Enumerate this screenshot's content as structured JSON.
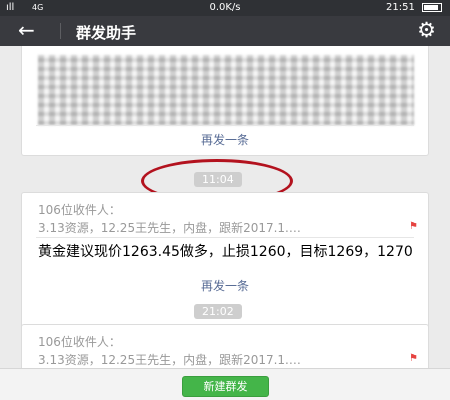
{
  "status_bar": {
    "signal": "ıll",
    "network": "4G",
    "speed": "0.0K/s",
    "time": "21:51",
    "battery_level": 0.9
  },
  "header": {
    "back_icon": "arrow-left-icon",
    "title": "群发助手",
    "settings_icon": "gear-icon"
  },
  "messages": [
    {
      "resend_label": "再发一条"
    },
    {
      "time": "11:04",
      "recipients_count": "106位收件人：",
      "recipients": "3.13资源，12.25王先生，内盘，跟新2017.1.…",
      "text": "黄金建议现价1263.45做多，止损1260，目标1269，1270",
      "resend_label": "再发一条"
    },
    {
      "time": "21:02",
      "recipients_count": "106位收件人：",
      "recipients": "3.13资源，12.25王先生，内盘，跟新2017.1.…"
    }
  ],
  "bottom": {
    "new_broadcast_label": "新建群发"
  },
  "colors": {
    "header_bg": "#393a3f",
    "link": "#576b95",
    "button_green": "#44b549",
    "annotation_red": "#b3121e"
  }
}
